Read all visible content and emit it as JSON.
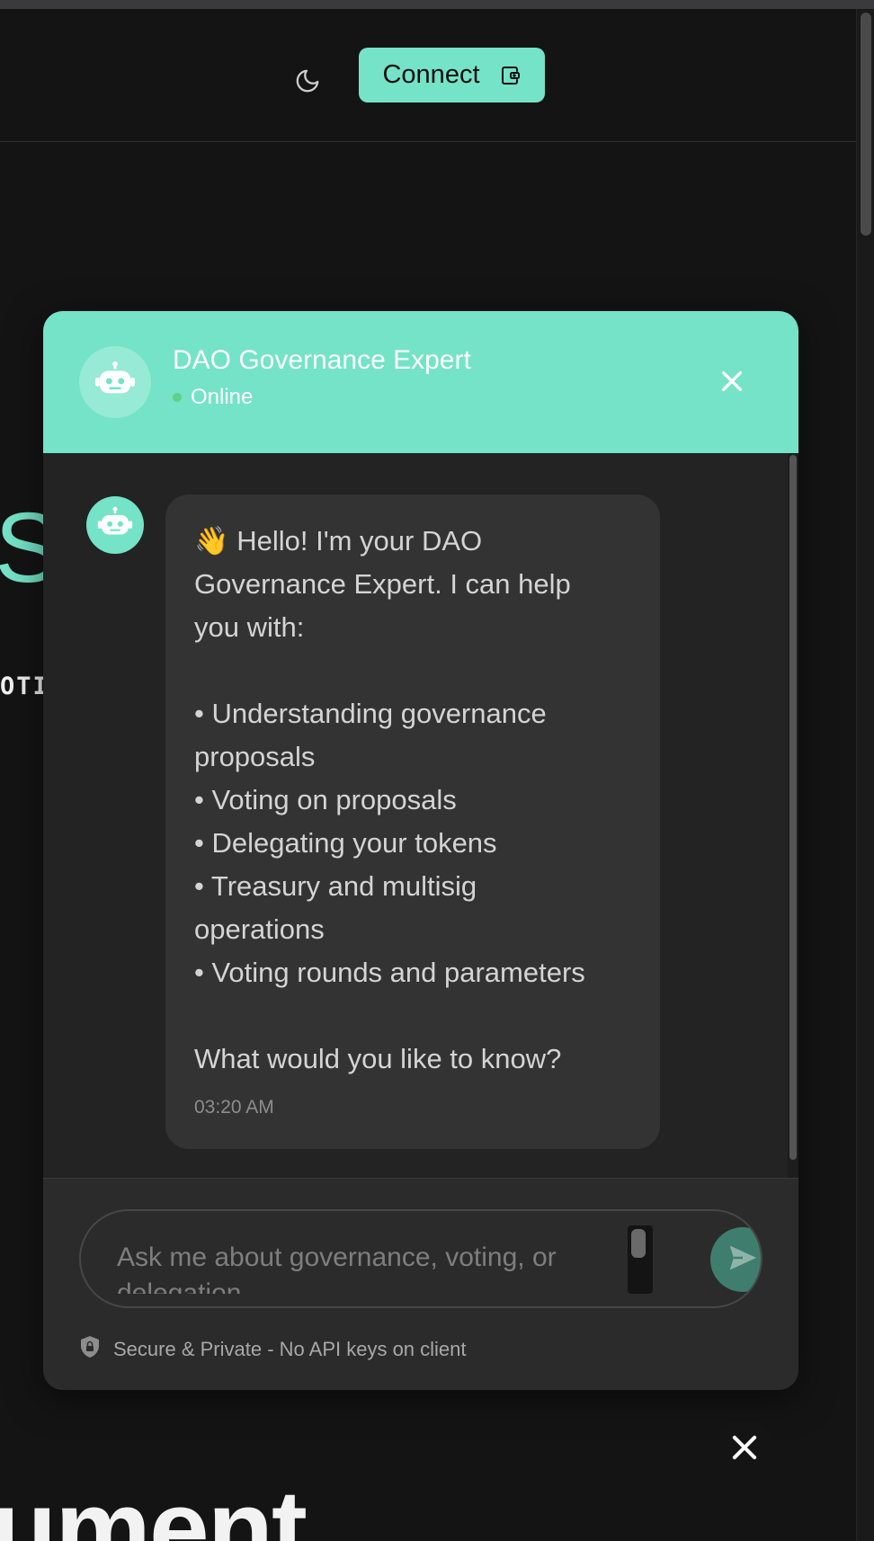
{
  "header": {
    "connect_label": "Connect"
  },
  "icons": {
    "theme": "moon-icon",
    "wallet": "wallet-icon",
    "bot": "robot-icon",
    "close": "close-icon",
    "send": "send-icon",
    "secure": "shield-lock-icon"
  },
  "colors": {
    "accent": "#74e3c7",
    "background": "#141414",
    "panel": "#232323",
    "bubble": "#333333",
    "online": "#5fd08a",
    "send_button": "#3f7e6e"
  },
  "background_page": {
    "heading_fragment": "S",
    "mono_fragment": "OTI",
    "bottom_fragment": "ument"
  },
  "chat": {
    "title": "DAO Governance Expert",
    "status": "Online",
    "message": {
      "lines": [
        "👋 Hello! I'm your DAO",
        "Governance Expert. I can help",
        "you with:",
        "",
        "• Understanding governance",
        "proposals",
        "• Voting on proposals",
        "• Delegating your tokens",
        "• Treasury and multisig",
        "operations",
        "• Voting rounds and parameters",
        "",
        "What would you like to know?"
      ],
      "time": "03:20 AM"
    },
    "input": {
      "placeholder": "Ask me about governance, voting, or delegation..."
    },
    "secure_note": "Secure & Private - No API keys on client"
  }
}
